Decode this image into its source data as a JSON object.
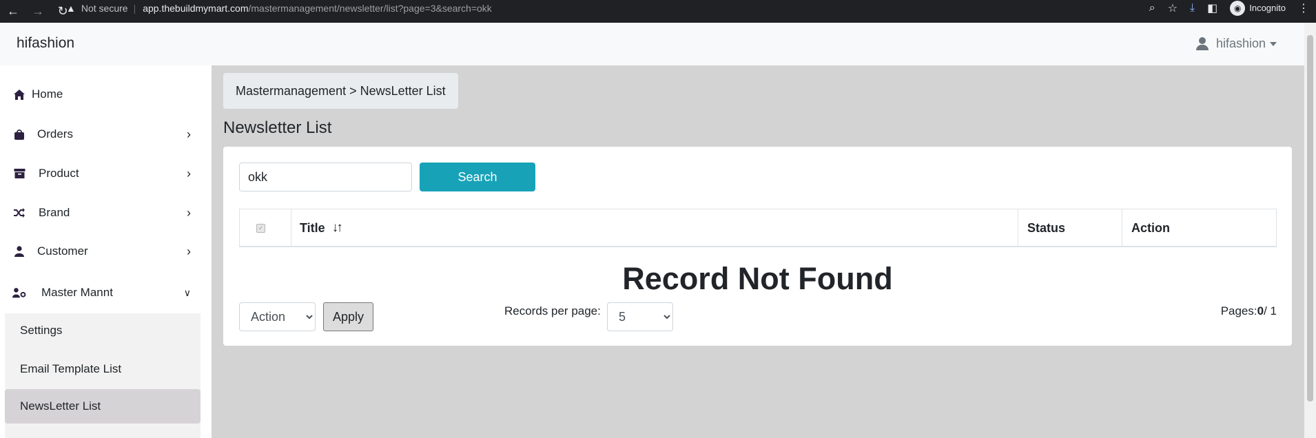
{
  "browser": {
    "security_label": "Not secure",
    "url_host": "app.thebuildmymart.com",
    "url_path": "/mastermanagement/newsletter/list?page=3&search=okk",
    "profile_label": "Incognito"
  },
  "topbar": {
    "brand": "hifashion",
    "user_name": "hifashion"
  },
  "sidebar": {
    "items": [
      {
        "label": "Home",
        "icon": "home-icon"
      },
      {
        "label": "Orders",
        "icon": "bag-icon"
      },
      {
        "label": "Product",
        "icon": "archive-icon"
      },
      {
        "label": "Brand",
        "icon": "shuffle-icon"
      },
      {
        "label": "Customer",
        "icon": "user-icon"
      },
      {
        "label": "Master Mannt",
        "icon": "user-gear-icon"
      }
    ],
    "submenu": [
      {
        "label": "Settings"
      },
      {
        "label": "Email Template List"
      },
      {
        "label": "NewsLetter List",
        "active": true
      }
    ]
  },
  "main": {
    "breadcrumb": "Mastermanagement > NewsLetter List",
    "title": "Newsletter List",
    "search": {
      "value": "okk",
      "button_label": "Search"
    },
    "table": {
      "columns": [
        "Title",
        "Status",
        "Action"
      ],
      "sort_glyph": "↓↑"
    },
    "empty_message": "Record Not Found",
    "bulk_action": {
      "selected": "Action",
      "apply_label": "Apply"
    },
    "records_per_page": {
      "label": "Records per page:",
      "selected": "5"
    },
    "pagination": {
      "label": "Pages:",
      "current": "0",
      "total": "/ 1"
    }
  },
  "colors": {
    "search_button": "#17a2b8",
    "content_bg": "#d3d3d3",
    "active_submenu": "#d6d3d6"
  }
}
